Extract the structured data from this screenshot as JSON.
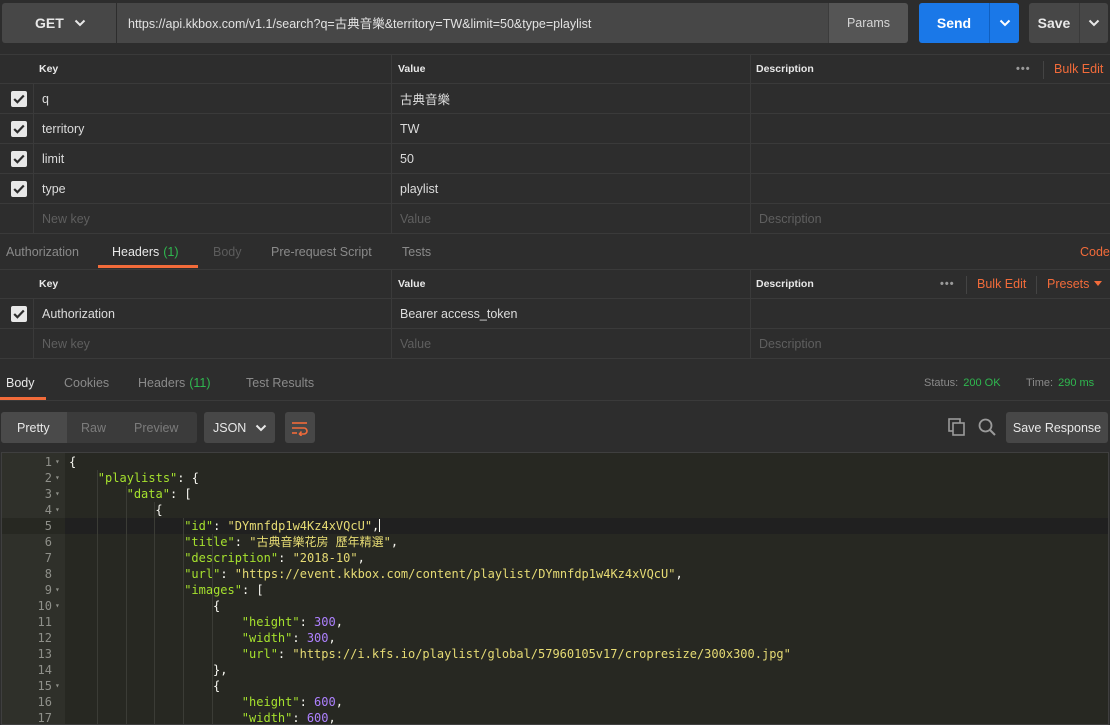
{
  "request": {
    "method": "GET",
    "url": "https://api.kkbox.com/v1.1/search?q=古典音樂&territory=TW&limit=50&type=playlist",
    "params_label": "Params",
    "send_label": "Send",
    "save_label": "Save"
  },
  "params_table": {
    "headers": {
      "key": "Key",
      "value": "Value",
      "description": "Description"
    },
    "bulk_edit": "Bulk Edit",
    "rows": [
      {
        "key": "q",
        "value": "古典音樂",
        "checked": true
      },
      {
        "key": "territory",
        "value": "TW",
        "checked": true
      },
      {
        "key": "limit",
        "value": "50",
        "checked": true
      },
      {
        "key": "type",
        "value": "playlist",
        "checked": true
      }
    ],
    "placeholder": {
      "key": "New key",
      "value": "Value",
      "description": "Description"
    }
  },
  "request_tabs": {
    "items": [
      {
        "label": "Authorization"
      },
      {
        "label": "Headers",
        "count": "(1)"
      },
      {
        "label": "Body"
      },
      {
        "label": "Pre-request Script"
      },
      {
        "label": "Tests"
      }
    ],
    "active": "Headers",
    "code_link": "Code"
  },
  "headers_table": {
    "headers": {
      "key": "Key",
      "value": "Value",
      "description": "Description"
    },
    "bulk_edit": "Bulk Edit",
    "presets": "Presets",
    "rows": [
      {
        "key": "Authorization",
        "value": "Bearer access_token",
        "checked": true
      }
    ],
    "placeholder": {
      "key": "New key",
      "value": "Value",
      "description": "Description"
    }
  },
  "response_tabs": {
    "items": [
      {
        "label": "Body"
      },
      {
        "label": "Cookies"
      },
      {
        "label": "Headers",
        "count": "(11)"
      },
      {
        "label": "Test Results"
      }
    ],
    "active": "Body",
    "status_label": "Status:",
    "status_value": "200 OK",
    "time_label": "Time:",
    "time_value": "290 ms"
  },
  "response_toolbar": {
    "views": [
      "Pretty",
      "Raw",
      "Preview"
    ],
    "active_view": "Pretty",
    "format": "JSON",
    "save_response": "Save Response"
  },
  "colors": {
    "accent": "#f26b3a",
    "send": "#1a78e8",
    "success": "#2fb84f"
  },
  "code_lines": [
    {
      "n": "1",
      "fold": true,
      "indent": 0,
      "parts": [
        [
          "p",
          "{"
        ]
      ]
    },
    {
      "n": "2",
      "fold": true,
      "indent": 1,
      "parts": [
        [
          "k",
          "\"playlists\""
        ],
        [
          "p",
          ": {"
        ]
      ]
    },
    {
      "n": "3",
      "fold": true,
      "indent": 2,
      "parts": [
        [
          "k",
          "\"data\""
        ],
        [
          "p",
          ": ["
        ]
      ]
    },
    {
      "n": "4",
      "fold": true,
      "indent": 3,
      "parts": [
        [
          "p",
          "{"
        ]
      ]
    },
    {
      "n": "5",
      "fold": false,
      "indent": 4,
      "hl": true,
      "parts": [
        [
          "k",
          "\"id\""
        ],
        [
          "p",
          ": "
        ],
        [
          "s",
          "\"DYmnfdp1w4Kz4xVQcU\""
        ],
        [
          "p",
          ","
        ]
      ]
    },
    {
      "n": "6",
      "fold": false,
      "indent": 4,
      "parts": [
        [
          "k",
          "\"title\""
        ],
        [
          "p",
          ": "
        ],
        [
          "s",
          "\"古典音樂花房 歷年精選\""
        ],
        [
          "p",
          ","
        ]
      ]
    },
    {
      "n": "7",
      "fold": false,
      "indent": 4,
      "parts": [
        [
          "k",
          "\"description\""
        ],
        [
          "p",
          ": "
        ],
        [
          "s",
          "\"2018-10\""
        ],
        [
          "p",
          ","
        ]
      ]
    },
    {
      "n": "8",
      "fold": false,
      "indent": 4,
      "parts": [
        [
          "k",
          "\"url\""
        ],
        [
          "p",
          ": "
        ],
        [
          "s",
          "\"https://event.kkbox.com/content/playlist/DYmnfdp1w4Kz4xVQcU\""
        ],
        [
          "p",
          ","
        ]
      ]
    },
    {
      "n": "9",
      "fold": true,
      "indent": 4,
      "parts": [
        [
          "k",
          "\"images\""
        ],
        [
          "p",
          ": ["
        ]
      ]
    },
    {
      "n": "10",
      "fold": true,
      "indent": 5,
      "parts": [
        [
          "p",
          "{"
        ]
      ]
    },
    {
      "n": "11",
      "fold": false,
      "indent": 6,
      "parts": [
        [
          "k",
          "\"height\""
        ],
        [
          "p",
          ": "
        ],
        [
          "n",
          "300"
        ],
        [
          "p",
          ","
        ]
      ]
    },
    {
      "n": "12",
      "fold": false,
      "indent": 6,
      "parts": [
        [
          "k",
          "\"width\""
        ],
        [
          "p",
          ": "
        ],
        [
          "n",
          "300"
        ],
        [
          "p",
          ","
        ]
      ]
    },
    {
      "n": "13",
      "fold": false,
      "indent": 6,
      "parts": [
        [
          "k",
          "\"url\""
        ],
        [
          "p",
          ": "
        ],
        [
          "s",
          "\"https://i.kfs.io/playlist/global/57960105v17/cropresize/300x300.jpg\""
        ]
      ]
    },
    {
      "n": "14",
      "fold": false,
      "indent": 5,
      "parts": [
        [
          "p",
          "},"
        ]
      ]
    },
    {
      "n": "15",
      "fold": true,
      "indent": 5,
      "parts": [
        [
          "p",
          "{"
        ]
      ]
    },
    {
      "n": "16",
      "fold": false,
      "indent": 6,
      "parts": [
        [
          "k",
          "\"height\""
        ],
        [
          "p",
          ": "
        ],
        [
          "n",
          "600"
        ],
        [
          "p",
          ","
        ]
      ]
    },
    {
      "n": "17",
      "fold": false,
      "indent": 6,
      "parts": [
        [
          "k",
          "\"width\""
        ],
        [
          "p",
          ": "
        ],
        [
          "n",
          "600"
        ],
        [
          "p",
          ","
        ]
      ]
    }
  ]
}
